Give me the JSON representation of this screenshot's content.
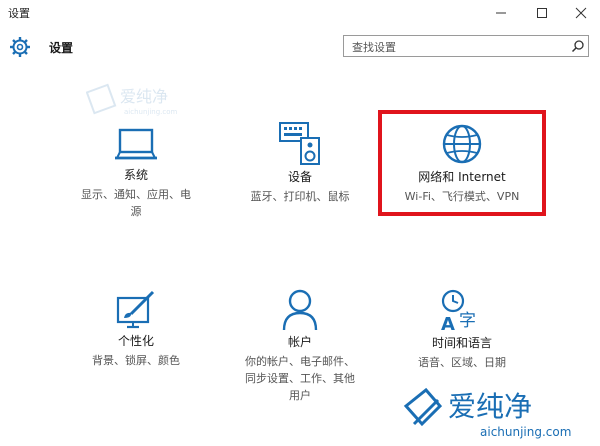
{
  "window": {
    "title": "设置"
  },
  "header": {
    "app_title": "设置",
    "search_placeholder": "查找设置"
  },
  "tiles": [
    {
      "name": "系统",
      "desc": [
        "显示、通知、应用、电",
        "源"
      ],
      "icon": "laptop-icon"
    },
    {
      "name": "设备",
      "desc": [
        "蓝牙、打印机、鼠标"
      ],
      "icon": "keyboard-speaker-icon"
    },
    {
      "name": "网络和 Internet",
      "desc": [
        "Wi-Fi、飞行模式、VPN"
      ],
      "icon": "globe-icon"
    },
    {
      "name": "个性化",
      "desc": [
        "背景、锁屏、颜色"
      ],
      "icon": "paint-screen-icon"
    },
    {
      "name": "帐户",
      "desc": [
        "你的帐户、电子邮件、",
        "同步设置、工作、其他",
        "用户"
      ],
      "icon": "person-icon"
    },
    {
      "name": "时间和语言",
      "desc": [
        "语音、区域、日期"
      ],
      "icon": "clock-language-icon"
    }
  ],
  "watermark": {
    "brand": "爱纯净",
    "url": "aichunjing.com"
  },
  "colors": {
    "accent": "#1a6eb4",
    "highlight": "#e0141c"
  }
}
